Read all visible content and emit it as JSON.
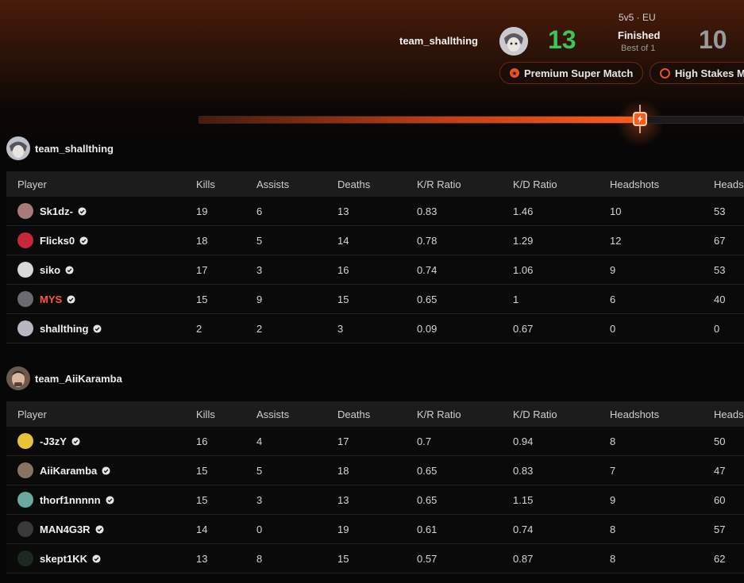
{
  "header": {
    "team_left": "team_shallthing",
    "score_left": "13",
    "score_right": "10",
    "mode": "5v5 · EU",
    "status": "Finished",
    "best_of": "Best of 1",
    "badges": [
      "Premium Super Match",
      "High Stakes M"
    ],
    "progress_percent": 80
  },
  "columns": [
    "Player",
    "Kills",
    "Assists",
    "Deaths",
    "K/R Ratio",
    "K/D Ratio",
    "Headshots",
    "Heads"
  ],
  "teams": [
    {
      "name": "team_shallthing",
      "players": [
        {
          "name": "Sk1dz-",
          "highlight": false,
          "stats": [
            "19",
            "6",
            "13",
            "0.83",
            "1.46",
            "10",
            "53"
          ],
          "avatar_color": "#a87a7a"
        },
        {
          "name": "Flicks0",
          "highlight": false,
          "stats": [
            "18",
            "5",
            "14",
            "0.78",
            "1.29",
            "12",
            "67"
          ],
          "avatar_color": "#c4283a"
        },
        {
          "name": "siko",
          "highlight": false,
          "stats": [
            "17",
            "3",
            "16",
            "0.74",
            "1.06",
            "9",
            "53"
          ],
          "avatar_color": "#d8d8d8"
        },
        {
          "name": "MYS",
          "highlight": true,
          "stats": [
            "15",
            "9",
            "15",
            "0.65",
            "1",
            "6",
            "40"
          ],
          "avatar_color": "#6a6a72"
        },
        {
          "name": "shallthing",
          "highlight": false,
          "stats": [
            "2",
            "2",
            "3",
            "0.09",
            "0.67",
            "0",
            "0"
          ],
          "avatar_color": "#b8b8c0"
        }
      ]
    },
    {
      "name": "team_AiiKaramba",
      "players": [
        {
          "name": "-J3zY",
          "highlight": false,
          "stats": [
            "16",
            "4",
            "17",
            "0.7",
            "0.94",
            "8",
            "50"
          ],
          "avatar_color": "#e8c23a"
        },
        {
          "name": "AiiKaramba",
          "highlight": false,
          "stats": [
            "15",
            "5",
            "18",
            "0.65",
            "0.83",
            "7",
            "47"
          ],
          "avatar_color": "#8a7260"
        },
        {
          "name": "thorf1nnnnn",
          "highlight": false,
          "stats": [
            "15",
            "3",
            "13",
            "0.65",
            "1.15",
            "9",
            "60"
          ],
          "avatar_color": "#6aa8a0"
        },
        {
          "name": "MAN4G3R",
          "highlight": false,
          "stats": [
            "14",
            "0",
            "19",
            "0.61",
            "0.74",
            "8",
            "57"
          ],
          "avatar_color": "#3a3a3a"
        },
        {
          "name": "skept1KK",
          "highlight": false,
          "stats": [
            "13",
            "8",
            "15",
            "0.57",
            "0.87",
            "8",
            "62"
          ],
          "avatar_color": "#1e2a20"
        }
      ]
    }
  ],
  "colors": {
    "accent": "#ff5a1a",
    "win_score": "#3fc45a",
    "lose_score": "#9a9a9a",
    "highlight_name": "#ff5a2a"
  }
}
